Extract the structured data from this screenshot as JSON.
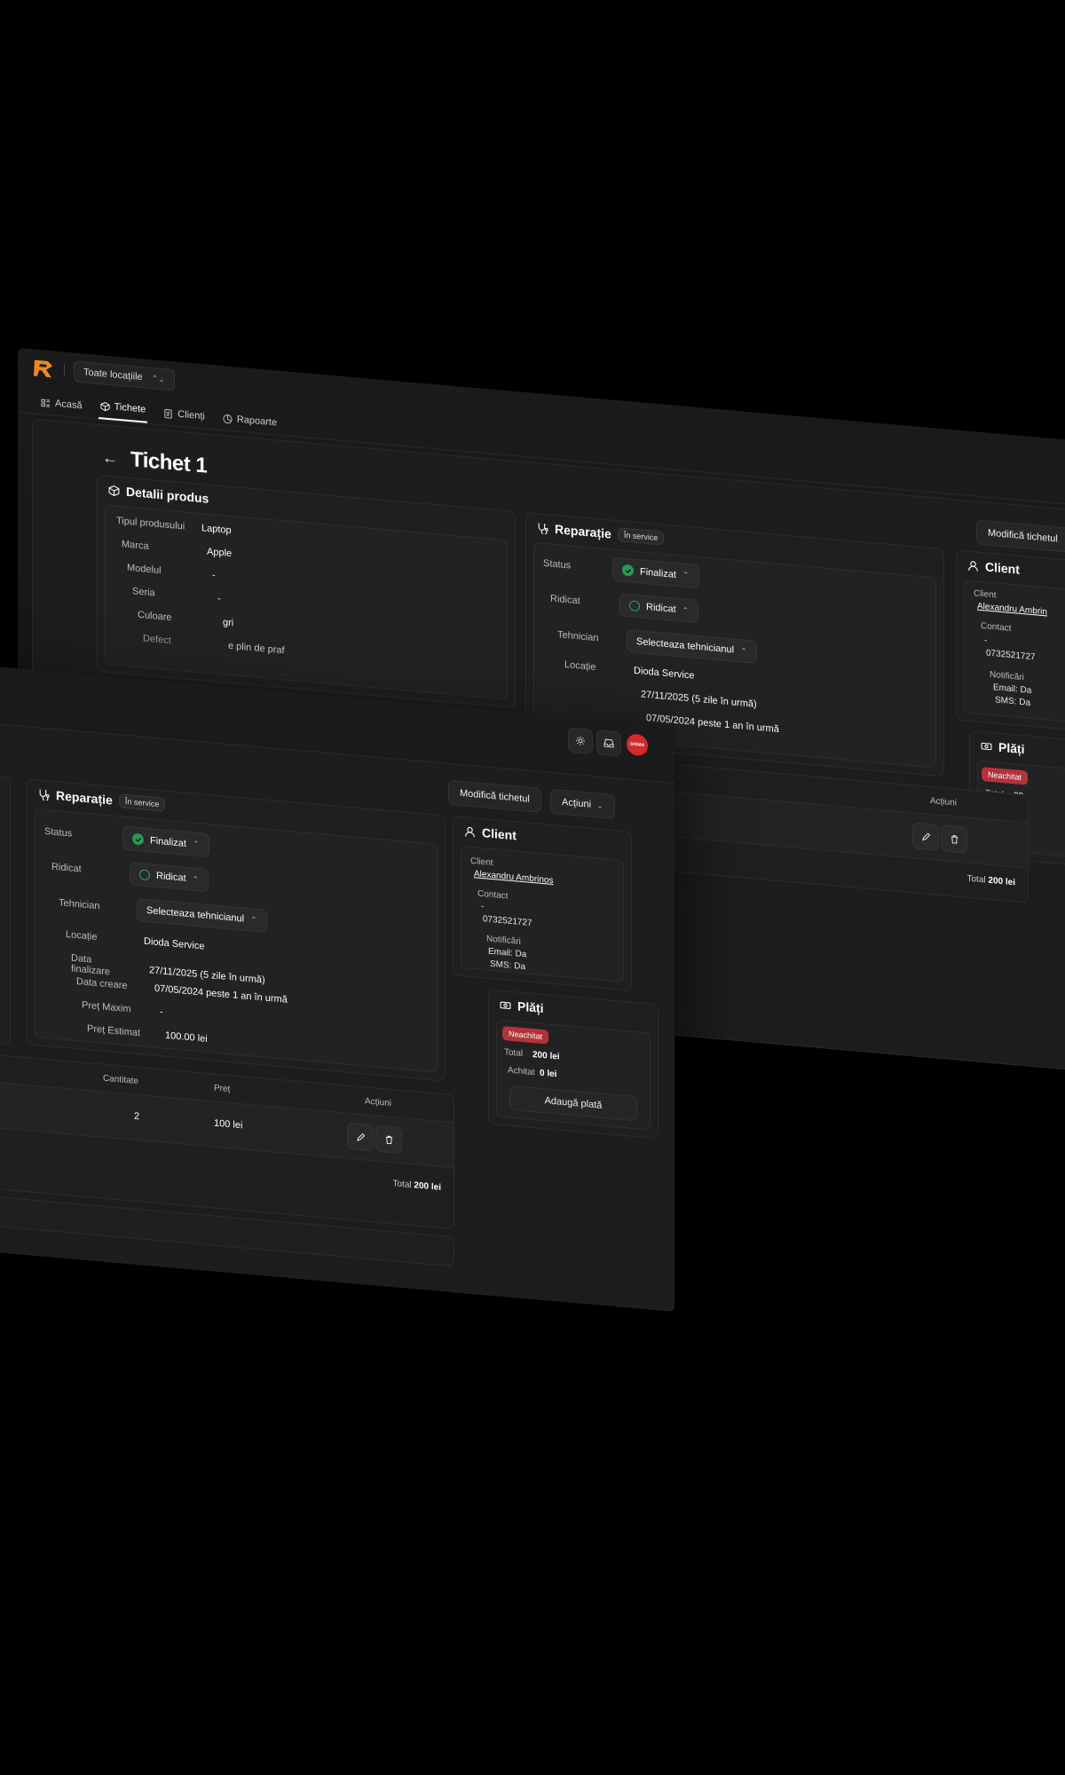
{
  "brand": {
    "accent": "#f28b1b"
  },
  "topbar": {
    "location_select": "Toate locațiile"
  },
  "nav": [
    {
      "label": "Acasă",
      "icon": "home-icon"
    },
    {
      "label": "Tichete",
      "icon": "box-icon",
      "active": true
    },
    {
      "label": "Clienți",
      "icon": "document-icon"
    },
    {
      "label": "Rapoarte",
      "icon": "chart-icon"
    }
  ],
  "page": {
    "title": "Tichet 1",
    "edit_button": "Modifică tichetul",
    "actions_button": "Acțiuni"
  },
  "product": {
    "title": "Detalii produs",
    "fields": [
      {
        "label": "Tipul produsului",
        "value": "Laptop"
      },
      {
        "label": "Marca",
        "value": "Apple"
      },
      {
        "label": "Modelul",
        "value": "-"
      },
      {
        "label": "Seria",
        "value": "-"
      },
      {
        "label": "Culoare",
        "value": "gri"
      },
      {
        "label": "Defect",
        "value": "e plin de praf"
      }
    ]
  },
  "repair": {
    "title": "Reparație",
    "badge": "În service",
    "status_label": "Status",
    "status_value": "Finalizat",
    "picked_label": "Ridicat",
    "picked_value": "Ridicat",
    "tech_label": "Tehnician",
    "tech_value": "Selecteaza tehnicianul",
    "location_label": "Locație",
    "location_value": "Dioda Service",
    "finish_label": "Data finalizare",
    "finish_value": "27/11/2025 (5 zile în urmă)",
    "created_label": "Data creare",
    "created_value": "07/05/2024 peste 1 an în urmă",
    "max_label": "Preț Maxim",
    "max_value": "-",
    "est_label": "Preț Estimat",
    "est_value": "100.00 lei"
  },
  "client": {
    "title": "Client",
    "client_label": "Client",
    "client_name": "Alexandru Ambrinos",
    "client_name_cut": "Alexandru Ambrin",
    "contact_label": "Contact",
    "contact_dash": "-",
    "contact_phone": "0732521727",
    "notif_label": "Notificări",
    "notif_email": "Email: Da",
    "notif_sms": "SMS: Da"
  },
  "payments": {
    "title": "Plăți",
    "status": "Neachitat",
    "status_cut": "Neachitat",
    "total_label": "Total",
    "total_value": "200 lei",
    "total_cut": "20",
    "paid_label": "Achitat",
    "paid_value": "0 lei",
    "add_button": "Adaugă plată"
  },
  "table": {
    "headers": {
      "quantity": "Cantitate",
      "price": "Preț",
      "actions": "Acțiuni"
    },
    "row": {
      "quantity": "2",
      "price": "100 lei"
    },
    "total_label": "Total",
    "total_value": "200 lei"
  },
  "user": {
    "avatar_text": "SIGMA"
  }
}
